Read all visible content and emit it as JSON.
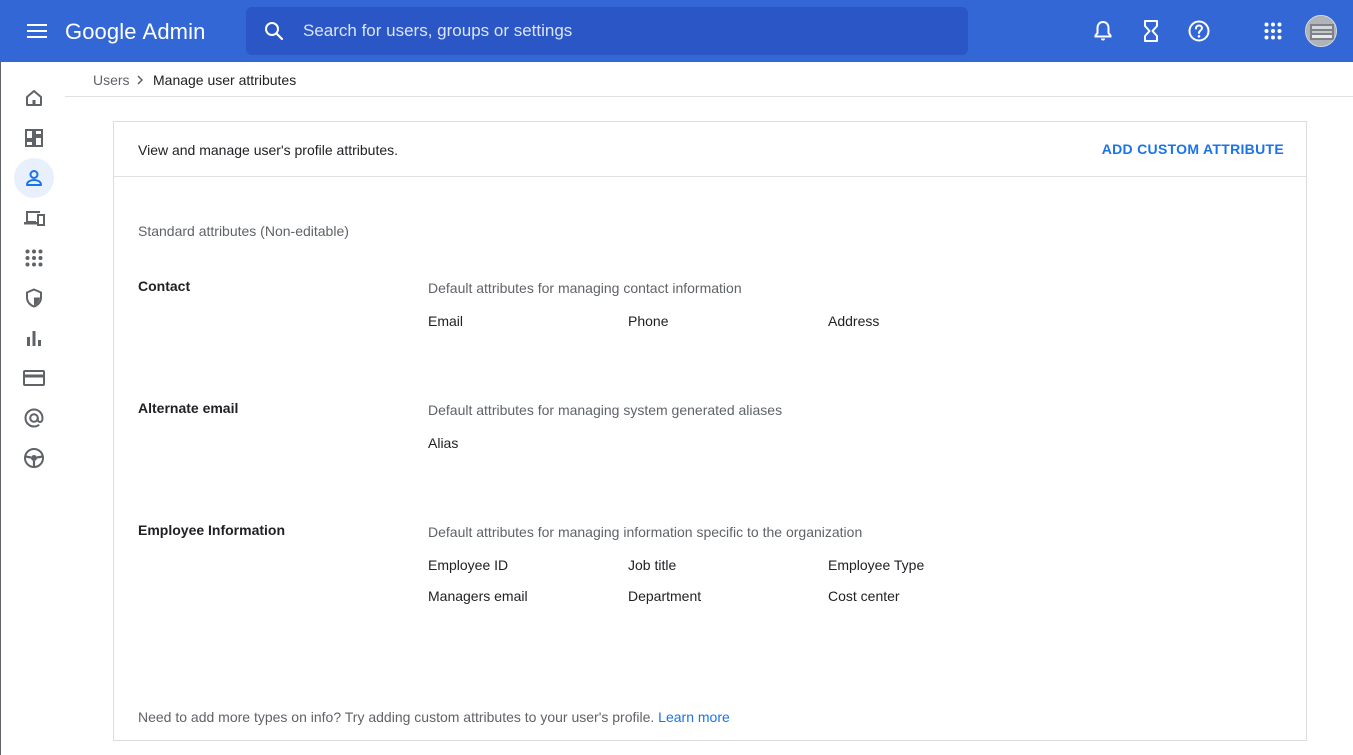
{
  "header": {
    "logo_google": "Google",
    "logo_admin": "Admin",
    "search_placeholder": "Search for users, groups or settings",
    "brand_color": "#3367d6"
  },
  "icons": {
    "menu": "hamburger-menu-icon",
    "search": "search-icon",
    "notifications": "bell-icon",
    "tasks": "hourglass-icon",
    "help": "help-icon",
    "apps": "apps-grid-icon"
  },
  "sidebar": {
    "items": [
      {
        "name": "home",
        "icon": "home-icon",
        "active": false
      },
      {
        "name": "dashboard",
        "icon": "dashboard-icon",
        "active": false
      },
      {
        "name": "users",
        "icon": "person-icon",
        "active": true
      },
      {
        "name": "devices",
        "icon": "devices-icon",
        "active": false
      },
      {
        "name": "apps",
        "icon": "apps-grid-icon",
        "active": false
      },
      {
        "name": "security",
        "icon": "shield-icon",
        "active": false
      },
      {
        "name": "reports",
        "icon": "bar-chart-icon",
        "active": false
      },
      {
        "name": "billing",
        "icon": "credit-card-icon",
        "active": false
      },
      {
        "name": "domains",
        "icon": "at-sign-icon",
        "active": false
      },
      {
        "name": "support",
        "icon": "support-icon",
        "active": false
      }
    ]
  },
  "breadcrumb": {
    "parent": "Users",
    "current": "Manage user attributes"
  },
  "card": {
    "description": "View and manage user's profile attributes.",
    "add_button": "ADD CUSTOM ATTRIBUTE",
    "section_title": "Standard attributes (Non-editable)",
    "groups": [
      {
        "label": "Contact",
        "description": "Default attributes for managing contact information",
        "attributes": [
          "Email",
          "Phone",
          "Address"
        ]
      },
      {
        "label": "Alternate email",
        "description": "Default attributes for managing system generated aliases",
        "attributes": [
          "Alias"
        ]
      },
      {
        "label": "Employee Information",
        "description": "Default attributes for managing information specific to the organization",
        "attributes": [
          "Employee ID",
          "Job title",
          "Employee Type",
          "Managers email",
          "Department",
          "Cost center"
        ]
      }
    ],
    "footer_text": "Need to add more types on info? Try adding custom attributes to your user's profile.",
    "footer_link": "Learn more"
  }
}
